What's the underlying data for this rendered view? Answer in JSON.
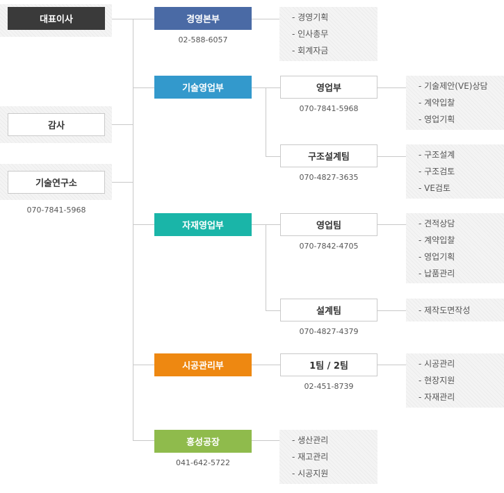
{
  "ceo": {
    "label": "대표이사"
  },
  "audit": {
    "label": "감사"
  },
  "rnd": {
    "label": "기술연구소",
    "phone": "070-7841-5968"
  },
  "divisions": [
    {
      "label": "경영본부",
      "color": "#4a6aa5",
      "phone": "02-588-6057",
      "tasks": [
        "- 경영기획",
        "- 인사총무",
        "- 회계자금"
      ]
    },
    {
      "label": "기술영업부",
      "color": "#3399cc",
      "teams": [
        {
          "label": "영업부",
          "phone": "070-7841-5968",
          "tasks": [
            "- 기술제안(VE)상담",
            "- 계약입찰",
            "- 영업기획"
          ]
        },
        {
          "label": "구조설계팀",
          "phone": "070-4827-3635",
          "tasks": [
            "- 구조설계",
            "- 구조검토",
            "- VE검토"
          ]
        }
      ]
    },
    {
      "label": "자재영업부",
      "color": "#1ab5a8",
      "teams": [
        {
          "label": "영업팀",
          "phone": "070-7842-4705",
          "tasks": [
            "- 견적상담",
            "- 계약입찰",
            "- 영업기획",
            "- 납품관리"
          ]
        },
        {
          "label": "설계팀",
          "phone": "070-4827-4379",
          "tasks": [
            "- 제작도면작성"
          ]
        }
      ]
    },
    {
      "label": "시공관리부",
      "color": "#ee8811",
      "teams": [
        {
          "label": "1팀 / 2팀",
          "phone": "02-451-8739",
          "tasks": [
            "- 시공관리",
            "- 현장지원",
            "- 자재관리"
          ]
        }
      ]
    },
    {
      "label": "홍성공장",
      "color": "#8fbb4c",
      "phone": "041-642-5722",
      "tasks": [
        "- 생산관리",
        "- 재고관리",
        "- 시공지원"
      ]
    }
  ]
}
